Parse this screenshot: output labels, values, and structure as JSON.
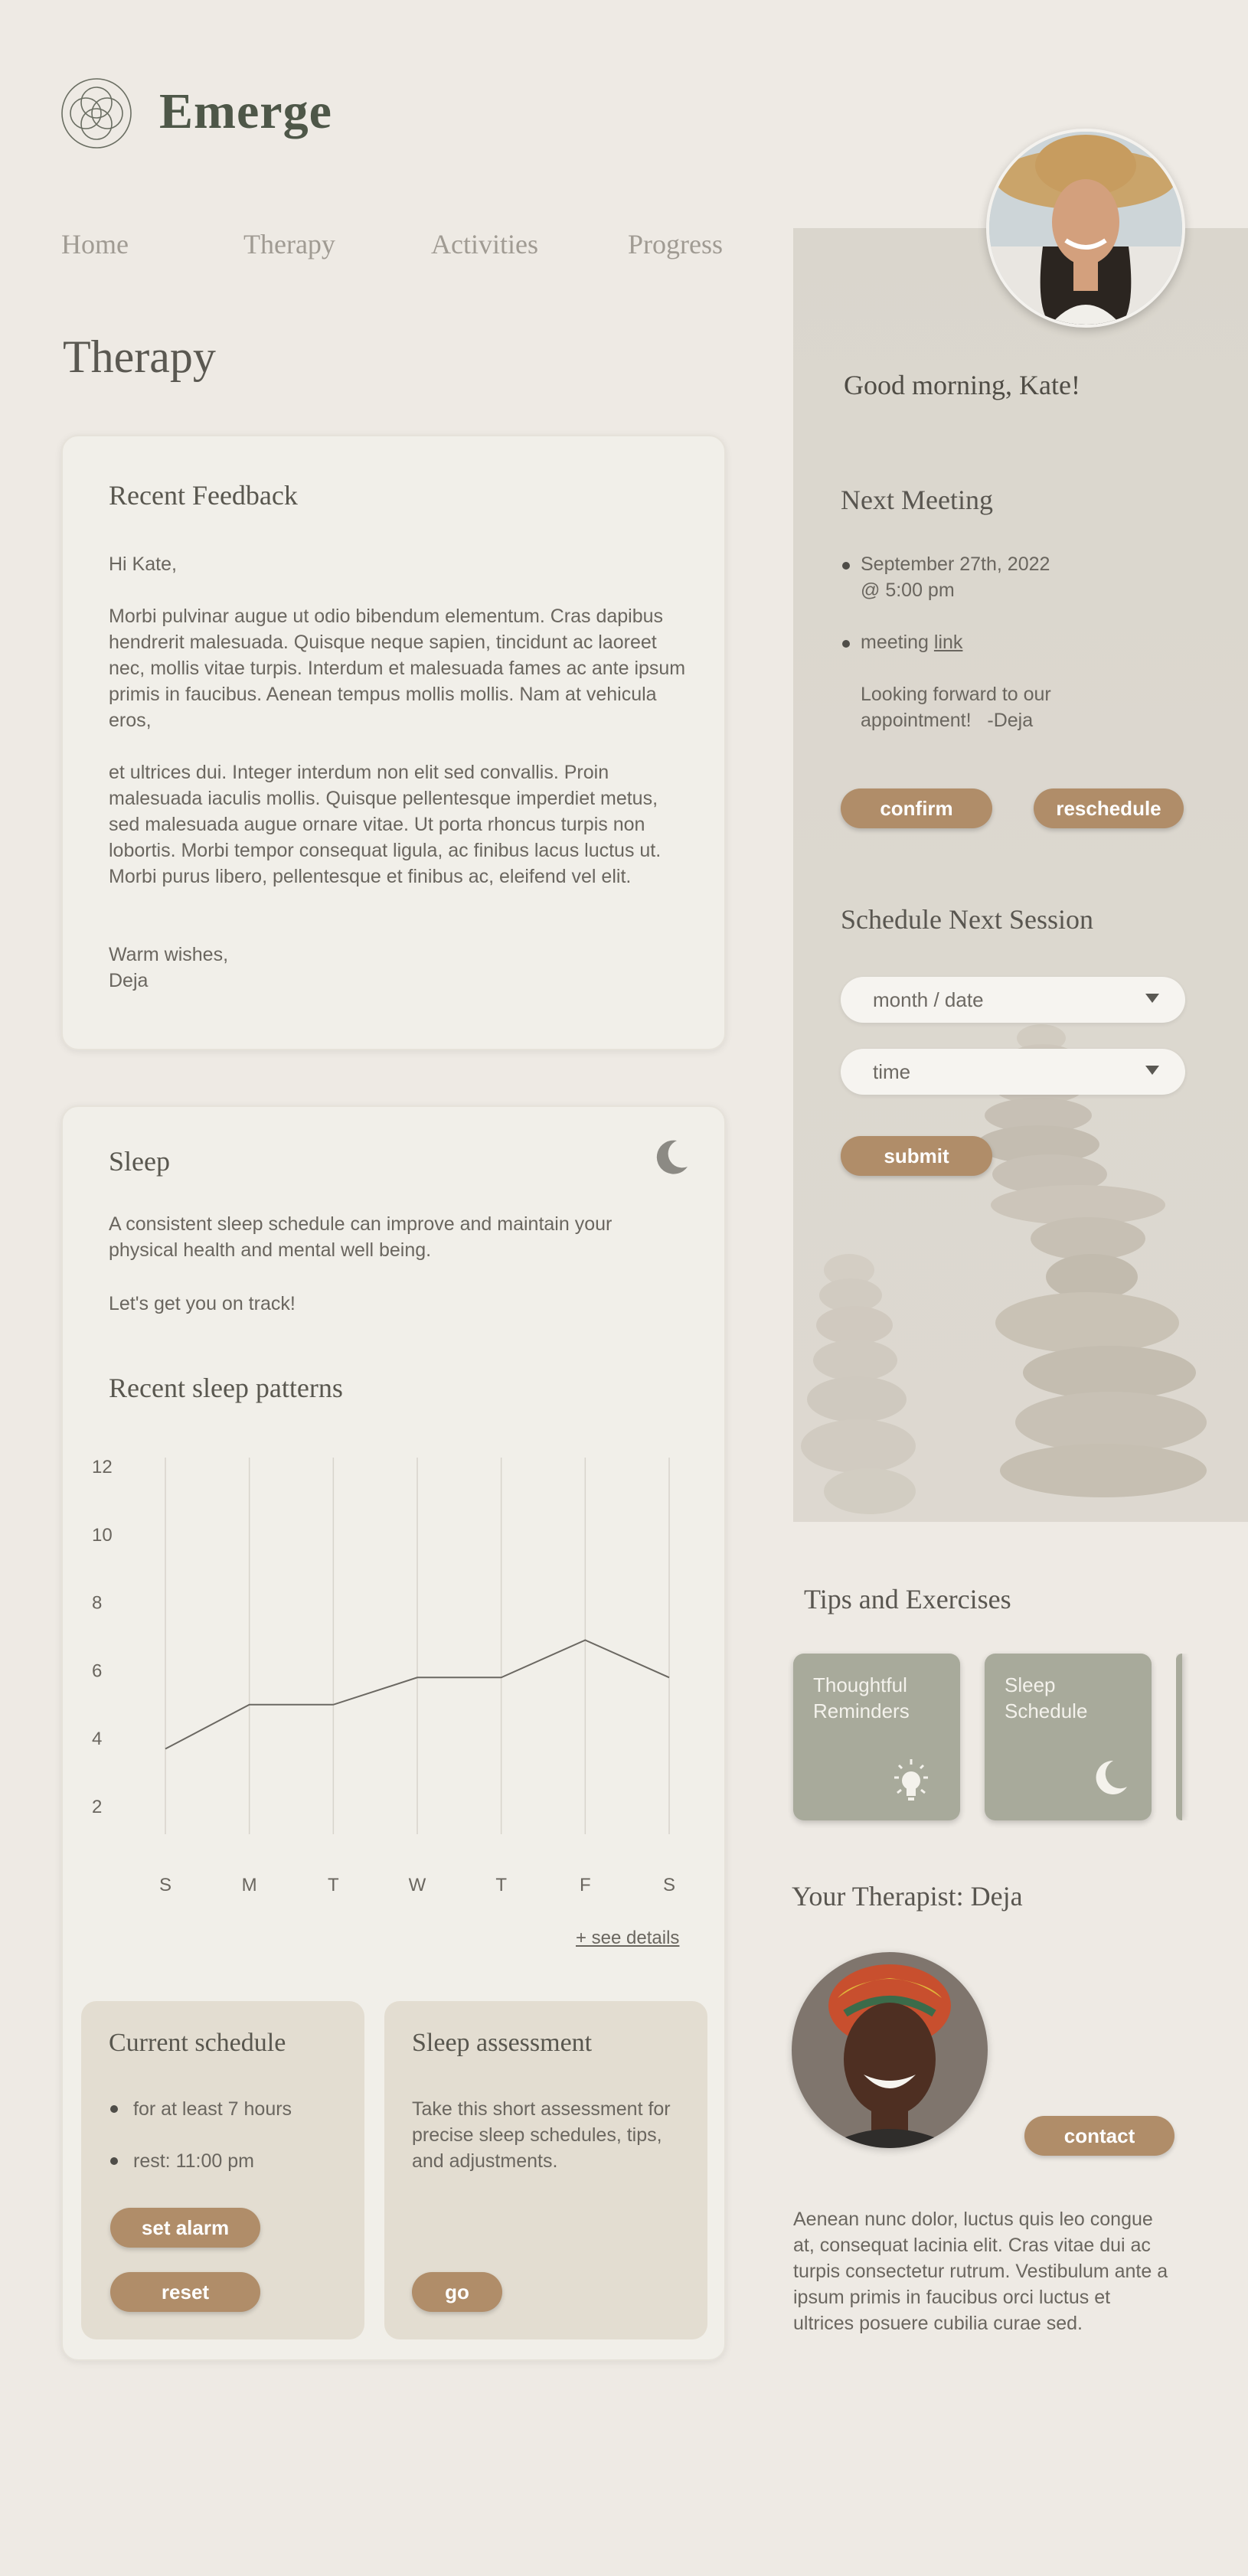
{
  "brand": "Emerge",
  "nav": [
    "Home",
    "Therapy",
    "Activities",
    "Progress"
  ],
  "page_title": "Therapy",
  "feedback": {
    "title": "Recent Feedback",
    "greeting": "Hi Kate,",
    "para1": "Morbi pulvinar augue ut odio bibendum elementum. Cras dapibus hendrerit malesuada. Quisque neque sapien, tincidunt ac laoreet nec, mollis vitae turpis. Interdum et malesuada fames ac ante ipsum primis in faucibus. Aenean tempus mollis mollis. Nam at vehicula eros,",
    "para2": "et ultrices dui. Integer interdum non elit sed convallis. Proin malesuada iaculis mollis. Quisque pellentesque imperdiet metus, sed malesuada augue ornare vitae. Ut porta rhoncus turpis non lobortis. Morbi tempor consequat ligula, ac finibus lacus luctus ut. Morbi purus libero, pellentesque et finibus ac, eleifend vel elit.",
    "signoff1": "Warm wishes,",
    "signoff2": "Deja"
  },
  "sleep": {
    "title": "Sleep",
    "intro": "A consistent sleep schedule can improve and maintain your physical health and mental well being.",
    "cta": "Let's get you on track!",
    "patterns_title": "Recent sleep patterns",
    "see_details": "+ see details",
    "schedule": {
      "title": "Current schedule",
      "item1": "for at least 7 hours",
      "item2": "rest: 11:00 pm",
      "alarm_btn": "set alarm",
      "reset_btn": "reset"
    },
    "assessment": {
      "title": "Sleep assessment",
      "text": "Take this short assessment for precise sleep schedules, tips, and adjustments.",
      "go_btn": "go"
    }
  },
  "chart_data": {
    "type": "line",
    "categories": [
      "S",
      "M",
      "T",
      "W",
      "T",
      "F",
      "S"
    ],
    "values": [
      3.7,
      5,
      5,
      5.8,
      5.8,
      6.9,
      5.8
    ],
    "ylim": [
      2,
      12
    ],
    "yticks": [
      "12",
      "10",
      "8",
      "6",
      "4",
      "2"
    ],
    "grid": "vertical",
    "color": "#6b6862"
  },
  "greeting": "Good morning, Kate!",
  "meeting": {
    "title": "Next Meeting",
    "date_line1": "September 27th, 2022",
    "date_line2": "@ 5:00 pm",
    "link_prefix": "meeting",
    "link_text": "link",
    "note_line1": "Looking forward to our",
    "note_line2": "appointment!   -Deja",
    "confirm_btn": "confirm",
    "reschedule_btn": "reschedule"
  },
  "schedule_next": {
    "title": "Schedule Next Session",
    "date_placeholder": "month / date",
    "time_placeholder": "time",
    "submit_btn": "submit"
  },
  "tips": {
    "title": "Tips and Exercises",
    "tiles": [
      "Thoughtful Reminders",
      "Sleep Schedule"
    ]
  },
  "therapist": {
    "title": "Your Therapist: Deja",
    "contact_btn": "contact",
    "bio": "Aenean nunc dolor, luctus quis leo congue at, consequat lacinia elit. Cras vitae dui ac turpis consectetur rutrum. Vestibulum ante a ipsum primis in faucibus orci luctus et ultrices posuere cubilia curae sed."
  },
  "colors": {
    "accent": "#b08d69",
    "background": "#eeeae4",
    "card": "#f1efe9",
    "tile": "#a8aa9b",
    "brand_green": "#4e5748"
  }
}
